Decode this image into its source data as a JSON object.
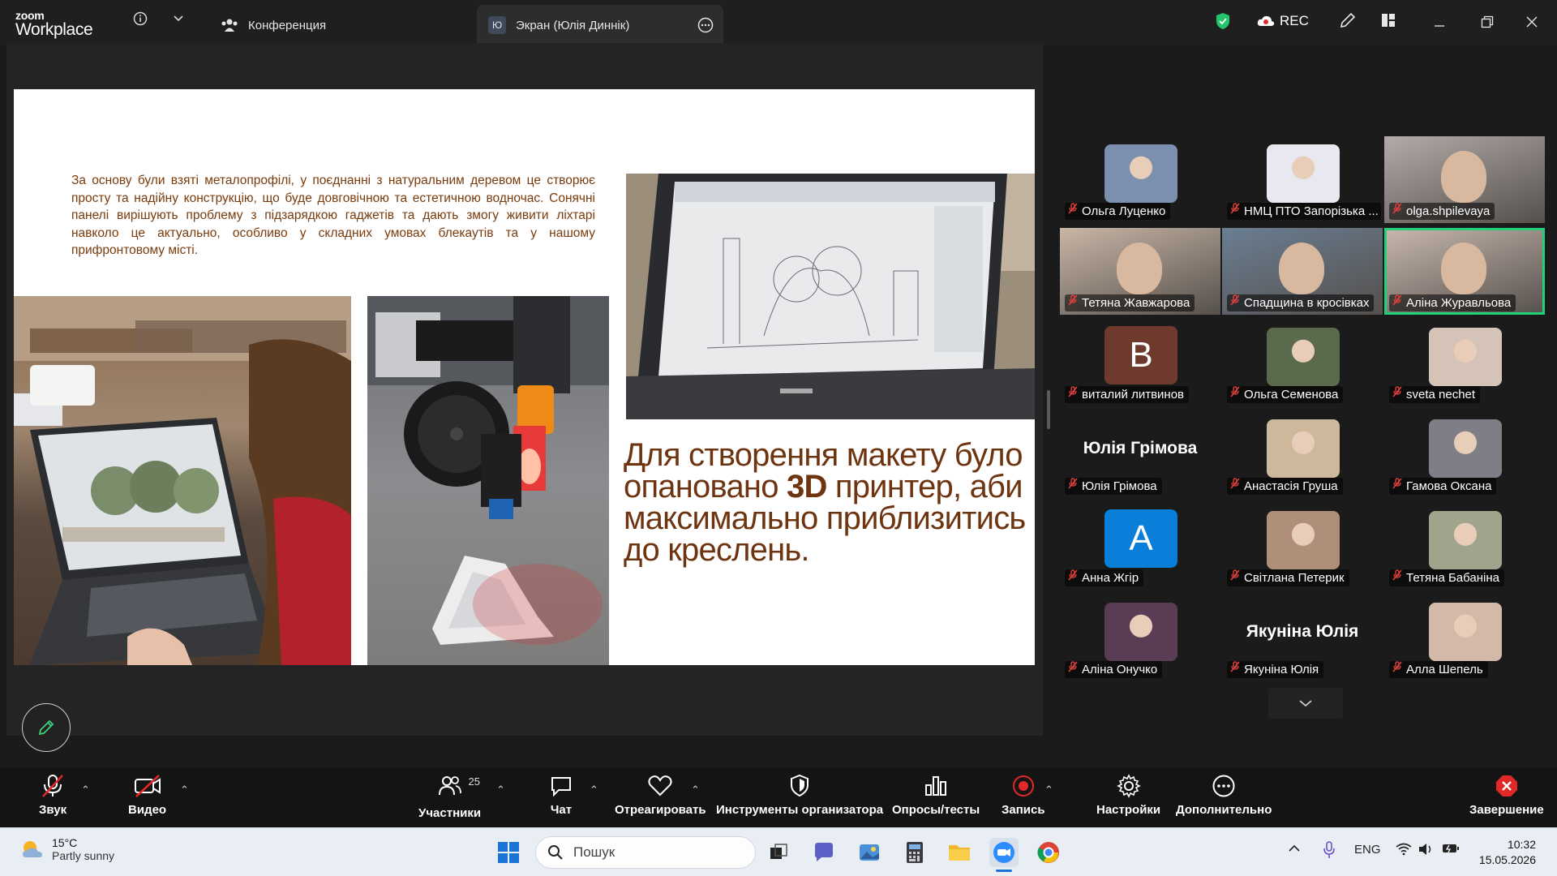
{
  "titlebar": {
    "logo_line1": "zoom",
    "logo_line2": "Workplace",
    "tab_conference": "Конференция",
    "tab_screen_avatar": "Ю",
    "tab_screen": "Экран (Юлія Диннік)",
    "rec_label": "REC"
  },
  "slide": {
    "paragraph": "За основу були взяті металопрофілі, у поєднанні з натуральним деревом це створює просту та надійну конструкцію, що буде довговічною та естетичною водночас.  Сонячні панелі вирішують проблему з підзарядкою гаджетів та дають змогу живити ліхтарі навколо це актуально, особливо у складних умовах блекаутів та у нашому прифронтовому місті.",
    "headline_before": "Для створення макету було опановано ",
    "headline_bold": "3D",
    "headline_after": " принтер, аби максимально приблизитись до креслень."
  },
  "participants": [
    {
      "name": "Ольга Луценко",
      "type": "photo",
      "tint": "#7d8fae"
    },
    {
      "name": "НМЦ ПТО Запорізька ...",
      "type": "photo",
      "tint": "#e8e8f0"
    },
    {
      "name": "olga.shpilevaya",
      "type": "video",
      "tint": "#b3aba7"
    },
    {
      "name": "Тетяна Жавжарова",
      "type": "video",
      "tint": "#c9b6a6"
    },
    {
      "name": "Спадщина в кросівках",
      "type": "video",
      "tint": "#6a7e93"
    },
    {
      "name": "Аліна Журавльова",
      "type": "video",
      "tint": "#c8b8ae"
    },
    {
      "name": "виталий литвинов",
      "type": "letter",
      "letter": "В",
      "tint": "#6e3a2e"
    },
    {
      "name": "Ольга Семенова",
      "type": "photo",
      "tint": "#5a6a4c"
    },
    {
      "name": "sveta nechet",
      "type": "photo",
      "tint": "#d6c3b8"
    },
    {
      "name": "Юлія Грімова",
      "type": "bigname",
      "bigname": "Юлія Грімова"
    },
    {
      "name": "Анастасія Груша",
      "type": "photo",
      "tint": "#cdb89b"
    },
    {
      "name": "Гамова Оксана",
      "type": "photo",
      "tint": "#7e7f86"
    },
    {
      "name": "Анна Жгір",
      "type": "letter",
      "letter": "А",
      "tint": "#0a7fd9"
    },
    {
      "name": "Світлана Петерик",
      "type": "photo",
      "tint": "#b08f7a"
    },
    {
      "name": "Тетяна Бабаніна",
      "type": "photo",
      "tint": "#a0a48c"
    },
    {
      "name": "Аліна Онучко",
      "type": "photo",
      "tint": "#5b3c55"
    },
    {
      "name": "Якуніна Юлія",
      "type": "bigname",
      "bigname": "Якуніна Юлія"
    },
    {
      "name": "Алла Шепель",
      "type": "photo",
      "tint": "#d3b9a8"
    }
  ],
  "toolbar": {
    "audio": "Звук",
    "video": "Видео",
    "participants": "Участники",
    "participants_count": "25",
    "chat": "Чат",
    "react": "Отреагировать",
    "host_tools": "Инструменты организатора",
    "polls": "Опросы/тесты",
    "record": "Запись",
    "settings": "Настройки",
    "more": "Дополнительно",
    "end": "Завершение"
  },
  "taskbar": {
    "temp": "15°C",
    "weather": "Partly sunny",
    "search_placeholder": "Пошук",
    "lang": "ENG",
    "time": "10:32",
    "date": "15.05.2026"
  },
  "colors": {
    "accent_green": "#21d17a",
    "record_red": "#e02828",
    "slide_text": "#7a3b0c"
  }
}
